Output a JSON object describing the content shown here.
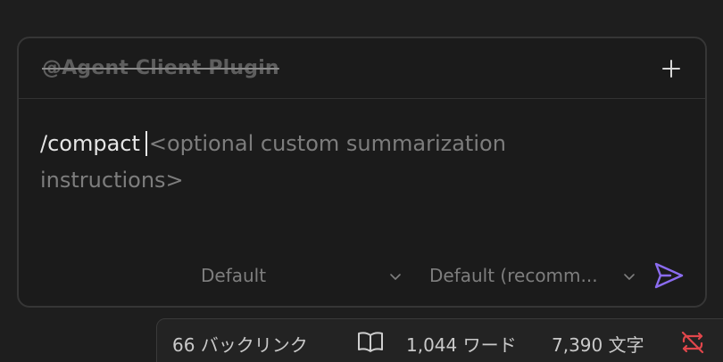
{
  "panel": {
    "plugin_name": "@Agent Client Plugin",
    "add_icon": "plus-icon"
  },
  "input": {
    "command": "/compact",
    "hint": "<optional custom summarization instructions>"
  },
  "selectors": {
    "model_value": "Default",
    "mode_value": "Default (recomm..."
  },
  "send_icon": "send-arrow-icon",
  "accent_color": "#8b6cf0",
  "status_bar": {
    "backlinks": "66 バックリンク",
    "words": "1,044 ワード",
    "chars": "7,390 文字",
    "reading_icon": "book-open-icon",
    "sync_icon": "sync-error-icon",
    "sync_color": "#e0464b"
  }
}
